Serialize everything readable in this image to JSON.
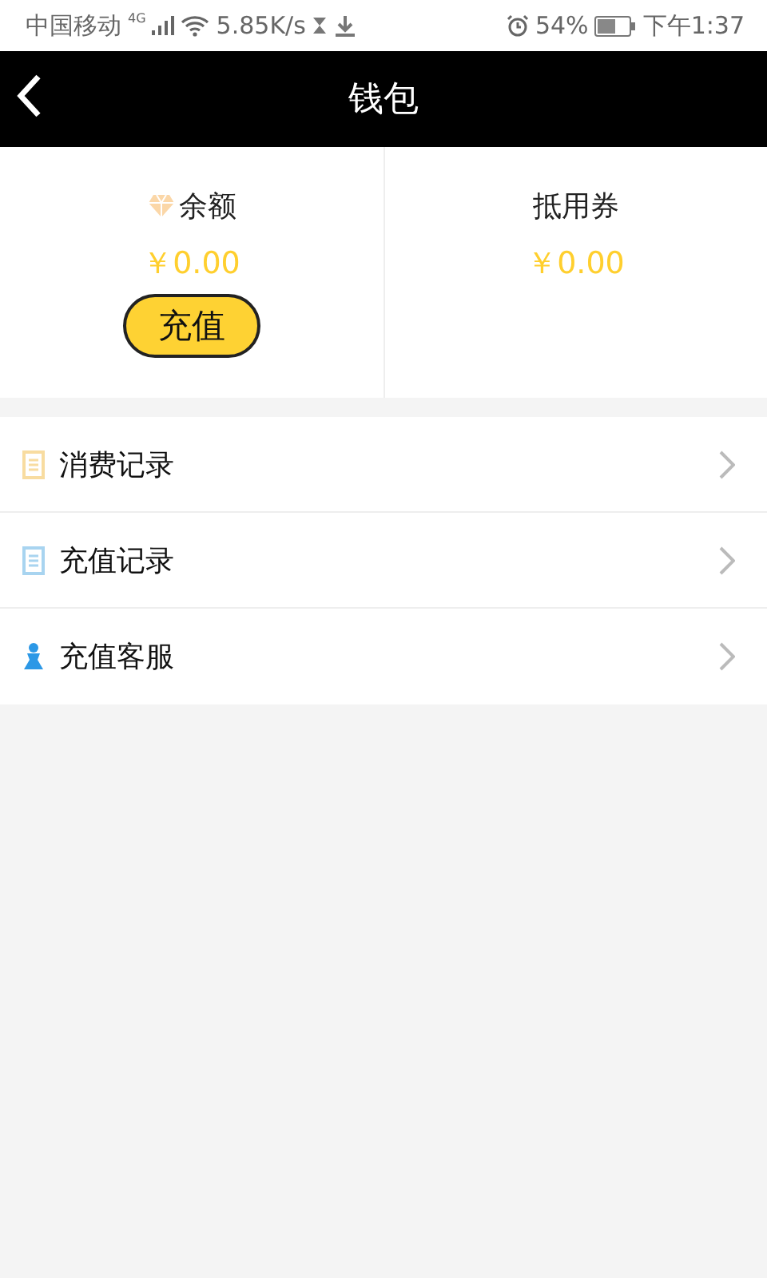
{
  "status_bar": {
    "carrier": "中国移动",
    "network": "4G",
    "speed": "5.85K/s",
    "battery": "54%",
    "time": "下午1:37"
  },
  "header": {
    "title": "钱包"
  },
  "balance": {
    "label": "余额",
    "amount": "￥0.00",
    "button": "充值"
  },
  "voucher": {
    "label": "抵用券",
    "amount": "￥0.00"
  },
  "menu": [
    {
      "label": "消费记录",
      "kind": "notes",
      "color": "#f8dca0"
    },
    {
      "label": "充值记录",
      "kind": "notes",
      "color": "#a8d4f0"
    },
    {
      "label": "充值客服",
      "kind": "person",
      "color": "#2c98e6"
    }
  ]
}
